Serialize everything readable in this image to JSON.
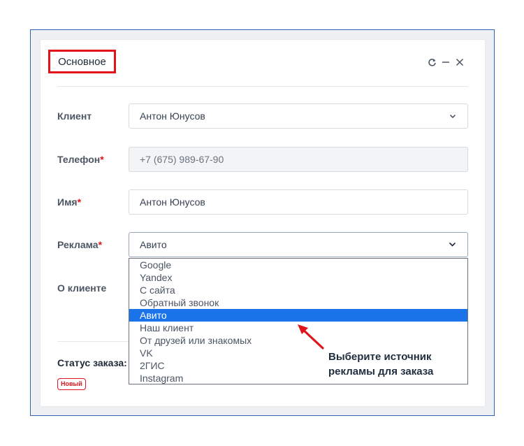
{
  "panel": {
    "title": "Основное"
  },
  "window_icons": [
    "refresh-icon",
    "minimize-icon",
    "close-icon"
  ],
  "fields": {
    "client": {
      "label": "Клиент",
      "value": "Антон Юнусов"
    },
    "phone": {
      "label": "Телефон",
      "required": "*",
      "value": "+7 (675) 989-67-90"
    },
    "name": {
      "label": "Имя",
      "required": "*",
      "value": "Антон Юнусов"
    },
    "ads": {
      "label": "Реклама",
      "required": "*",
      "value": "Авито"
    },
    "about": {
      "label": "О клиенте"
    }
  },
  "ads_options": [
    {
      "label": "Google",
      "selected": false
    },
    {
      "label": "Yandex",
      "selected": false
    },
    {
      "label": "С сайта",
      "selected": false
    },
    {
      "label": "Обратный звонок",
      "selected": false
    },
    {
      "label": "Авито",
      "selected": true
    },
    {
      "label": "Наш клиент",
      "selected": false
    },
    {
      "label": "От друзей или знакомых",
      "selected": false
    },
    {
      "label": "VK",
      "selected": false
    },
    {
      "label": "2ГИС",
      "selected": false
    },
    {
      "label": "Instagram",
      "selected": false
    }
  ],
  "order_status": {
    "label": "Статус заказа:",
    "badge": "Новый"
  },
  "annotation": {
    "line1": "Выберите источник",
    "line2": "рекламы для заказа"
  },
  "colors": {
    "accent": "#1a73e8",
    "highlight": "#e0141b",
    "frame": "#2f63b3"
  }
}
